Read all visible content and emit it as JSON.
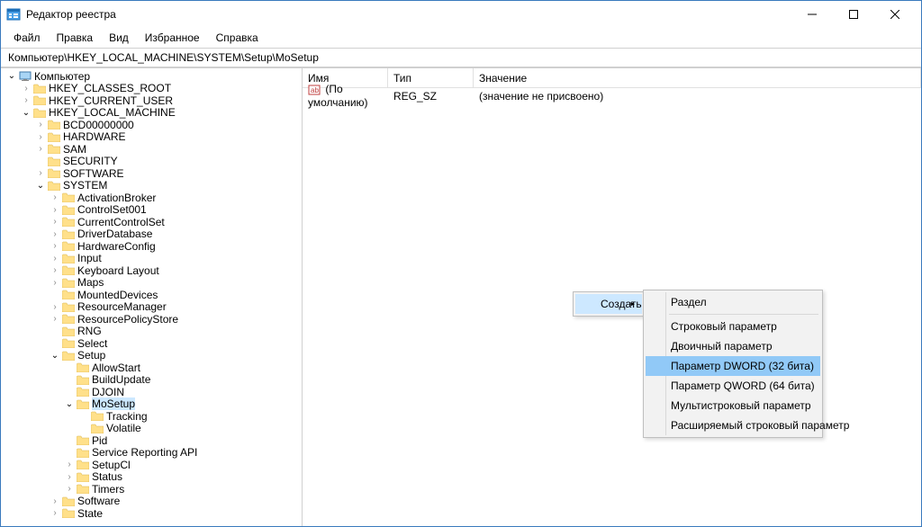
{
  "window": {
    "title": "Редактор реестра"
  },
  "menu": {
    "file": "Файл",
    "edit": "Правка",
    "view": "Вид",
    "favorites": "Избранное",
    "help": "Справка"
  },
  "address": "Компьютер\\HKEY_LOCAL_MACHINE\\SYSTEM\\Setup\\MoSetup",
  "tree": {
    "root": "Компьютер",
    "hkcr": "HKEY_CLASSES_ROOT",
    "hkcu": "HKEY_CURRENT_USER",
    "hklm": "HKEY_LOCAL_MACHINE",
    "bcd": "BCD00000000",
    "hardware": "HARDWARE",
    "sam": "SAM",
    "security": "SECURITY",
    "software": "SOFTWARE",
    "system": "SYSTEM",
    "activationbroker": "ActivationBroker",
    "controlset001": "ControlSet001",
    "currentcontrolset": "CurrentControlSet",
    "driverdatabase": "DriverDatabase",
    "hardwareconfig": "HardwareConfig",
    "input": "Input",
    "keyboardlayout": "Keyboard Layout",
    "maps": "Maps",
    "mounteddevices": "MountedDevices",
    "resourcemanager": "ResourceManager",
    "resourcepolicystore": "ResourcePolicyStore",
    "rng": "RNG",
    "select": "Select",
    "setup": "Setup",
    "allowstart": "AllowStart",
    "buildupdate": "BuildUpdate",
    "djoin": "DJOIN",
    "mosetup": "MoSetup",
    "tracking": "Tracking",
    "volatile": "Volatile",
    "pid": "Pid",
    "servicereportingapi": "Service Reporting API",
    "setupcl": "SetupCl",
    "status": "Status",
    "timers": "Timers",
    "software2": "Software",
    "state": "State"
  },
  "list": {
    "hdr_name": "Имя",
    "hdr_type": "Тип",
    "hdr_value": "Значение",
    "row0_name": "(По умолчанию)",
    "row0_type": "REG_SZ",
    "row0_value": "(значение не присвоено)"
  },
  "ctx1": {
    "create": "Создать"
  },
  "ctx2": {
    "key": "Раздел",
    "string": "Строковый параметр",
    "binary": "Двоичный параметр",
    "dword": "Параметр DWORD (32 бита)",
    "qword": "Параметр QWORD (64 бита)",
    "multistring": "Мультистроковый параметр",
    "expandstring": "Расширяемый строковый параметр"
  }
}
